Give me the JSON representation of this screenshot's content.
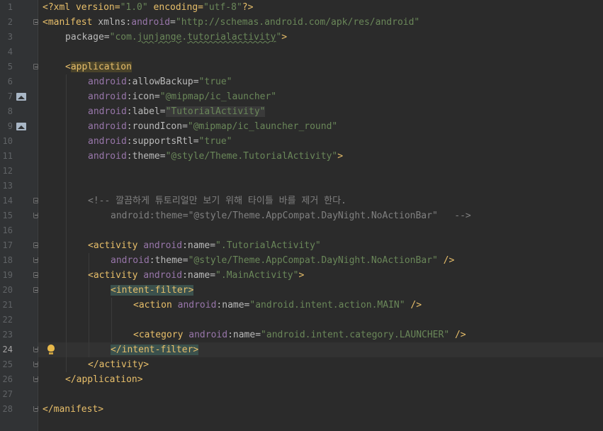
{
  "editor": {
    "current_line": 24,
    "lines": [
      {
        "n": "1"
      },
      {
        "n": "2"
      },
      {
        "n": "3"
      },
      {
        "n": "4"
      },
      {
        "n": "5"
      },
      {
        "n": "6"
      },
      {
        "n": "7"
      },
      {
        "n": "8"
      },
      {
        "n": "9"
      },
      {
        "n": "10"
      },
      {
        "n": "11"
      },
      {
        "n": "12"
      },
      {
        "n": "13"
      },
      {
        "n": "14"
      },
      {
        "n": "15"
      },
      {
        "n": "16"
      },
      {
        "n": "17"
      },
      {
        "n": "18"
      },
      {
        "n": "19"
      },
      {
        "n": "20"
      },
      {
        "n": "21"
      },
      {
        "n": "22"
      },
      {
        "n": "23"
      },
      {
        "n": "24"
      },
      {
        "n": "25"
      },
      {
        "n": "26"
      },
      {
        "n": "27"
      },
      {
        "n": "28"
      }
    ],
    "code": {
      "l1_decl": "<?xml version=",
      "l1_ver": "\"1.0\"",
      "l1_enc": " encoding=",
      "l1_encval": "\"utf-8\"",
      "l1_end": "?>",
      "l2_open": "<manifest",
      "l2_attr": " xmlns:",
      "l2_ns": "android",
      "l2_eq": "=",
      "l2_val": "\"http://schemas.android.com/apk/res/android\"",
      "l3_attr": "package=",
      "l3_val_a": "\"com.",
      "l3_val_b": "junjange",
      "l3_val_c": ".",
      "l3_val_d": "tutorialactivity",
      "l3_val_e": "\"",
      "l3_end": ">",
      "l5_lt": "<",
      "l5_tag": "application",
      "android": "android",
      "colon": ":",
      "l6_attr": "allowBackup=",
      "l6_val": "\"true\"",
      "l7_attr": "icon=",
      "l7_val": "\"@mipmap/ic_launcher\"",
      "l8_attr": "label=",
      "l8_val": "\"TutorialActivity\"",
      "l9_attr": "roundIcon=",
      "l9_val": "\"@mipmap/ic_launcher_round\"",
      "l10_attr": "supportsRtl=",
      "l10_val": "\"true\"",
      "l11_attr": "theme=",
      "l11_val": "\"@style/Theme.TutorialActivity\"",
      "l11_end": ">",
      "l14_comment": "<!-- 깔끔하게 튜토리얼만 보기 위해 타이틀 바를 제거 한다.",
      "l15_comment": "android:theme=\"@style/Theme.AppCompat.DayNight.NoActionBar\"   -->",
      "l17_open": "<activity",
      "l17_attr": "name=",
      "l17_val": "\".TutorialActivity\"",
      "l18_attr": "theme=",
      "l18_val": "\"@style/Theme.AppCompat.DayNight.NoActionBar\"",
      "l18_end": " />",
      "l19_open": "<activity",
      "l19_attr": "name=",
      "l19_val": "\".MainActivity\"",
      "l19_end": ">",
      "l20_tag": "<intent-filter>",
      "l21_open": "<action",
      "l21_attr": "name=",
      "l21_val": "\"android.intent.action.MAIN\"",
      "l21_end": " />",
      "l23_open": "<category",
      "l23_attr": "name=",
      "l23_val": "\"android.intent.category.LAUNCHER\"",
      "l23_end": " />",
      "l24_a": "</intent-fi",
      "l24_b": "lter>",
      "l25_tag": "</activity>",
      "l26_tag": "</application>",
      "l28_tag": "</manifest>"
    }
  }
}
